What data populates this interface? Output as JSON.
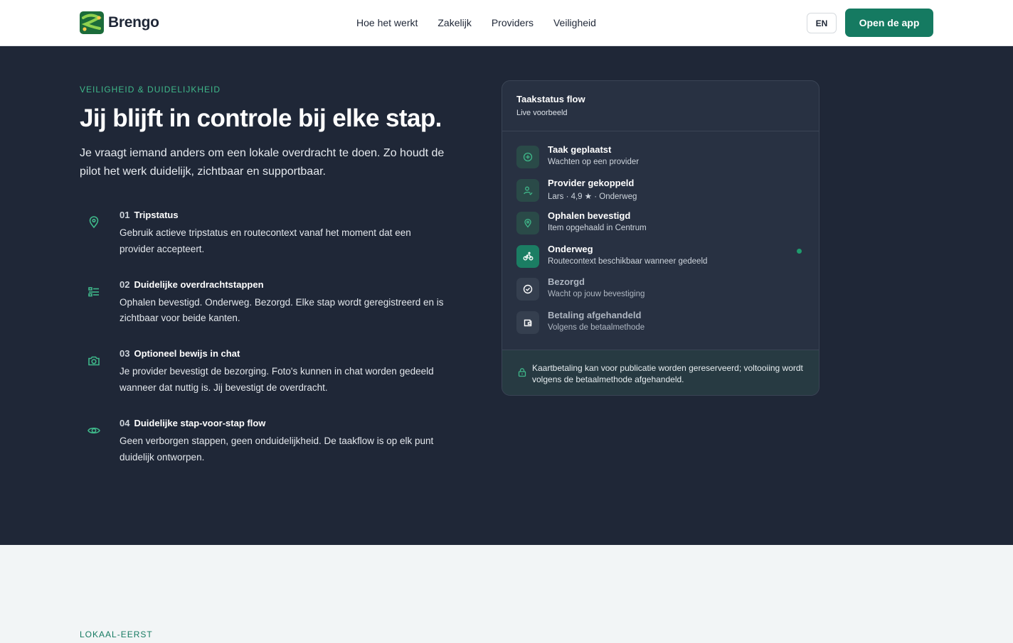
{
  "header": {
    "brand": "Brengo",
    "nav": [
      "Hoe het werkt",
      "Zakelijk",
      "Providers",
      "Veiligheid"
    ],
    "lang": "EN",
    "cta": "Open de app"
  },
  "hero": {
    "eyebrow": "VEILIGHEID & DUIDELIJKHEID",
    "title": "Jij blijft in controle bij elke stap.",
    "intro": "Je vraagt iemand anders om een lokale overdracht te doen. Zo houdt de pilot het werk duidelijk, zichtbaar en supportbaar."
  },
  "features": [
    {
      "num": "01",
      "title": "Tripstatus",
      "desc": "Gebruik actieve tripstatus en routecontext vanaf het moment dat een provider accepteert.",
      "icon": "map-pin-icon"
    },
    {
      "num": "02",
      "title": "Duidelijke overdrachtstappen",
      "desc": "Ophalen bevestigd. Onderweg. Bezorgd. Elke stap wordt geregistreerd en is zichtbaar voor beide kanten.",
      "icon": "list-icon"
    },
    {
      "num": "03",
      "title": "Optioneel bewijs in chat",
      "desc": "Je provider bevestigt de bezorging. Foto's kunnen in chat worden gedeeld wanneer dat nuttig is. Jij bevestigt de overdracht.",
      "icon": "camera-icon"
    },
    {
      "num": "04",
      "title": "Duidelijke stap-voor-stap flow",
      "desc": "Geen verborgen stappen, geen onduidelijkheid. De taakflow is op elk punt duidelijk ontworpen.",
      "icon": "eye-icon"
    }
  ],
  "card": {
    "title": "Taakstatus flow",
    "subtitle": "Live voorbeeld",
    "steps": [
      {
        "title": "Taak geplaatst",
        "desc": "Wachten op een provider",
        "state": "done",
        "icon": "plus-circle-icon"
      },
      {
        "title": "Provider gekoppeld",
        "desc": "Lars · 4,9 ★ · Onderweg",
        "state": "done",
        "icon": "user-check-icon"
      },
      {
        "title": "Ophalen bevestigd",
        "desc": "Item opgehaald in Centrum",
        "state": "done",
        "icon": "map-pin-icon"
      },
      {
        "title": "Onderweg",
        "desc": "Routecontext beschikbaar wanneer gedeeld",
        "state": "active",
        "icon": "bike-icon"
      },
      {
        "title": "Bezorgd",
        "desc": "Wacht op jouw bevestiging",
        "state": "pending",
        "icon": "check-circle-icon"
      },
      {
        "title": "Betaling afgehandeld",
        "desc": "Volgens de betaalmethode",
        "state": "pending",
        "icon": "wallet-icon"
      }
    ],
    "footer": "Kaartbetaling kan voor publicatie worden gereserveerd; voltooiing wordt volgens de betaalmethode afgehandeld."
  },
  "section2": {
    "eyebrow": "LOKAAL-EERST"
  },
  "colors": {
    "accent": "#157a61",
    "accent_light": "#3fb88a",
    "dark_bg": "#1f2737",
    "card_bg": "#283142"
  }
}
